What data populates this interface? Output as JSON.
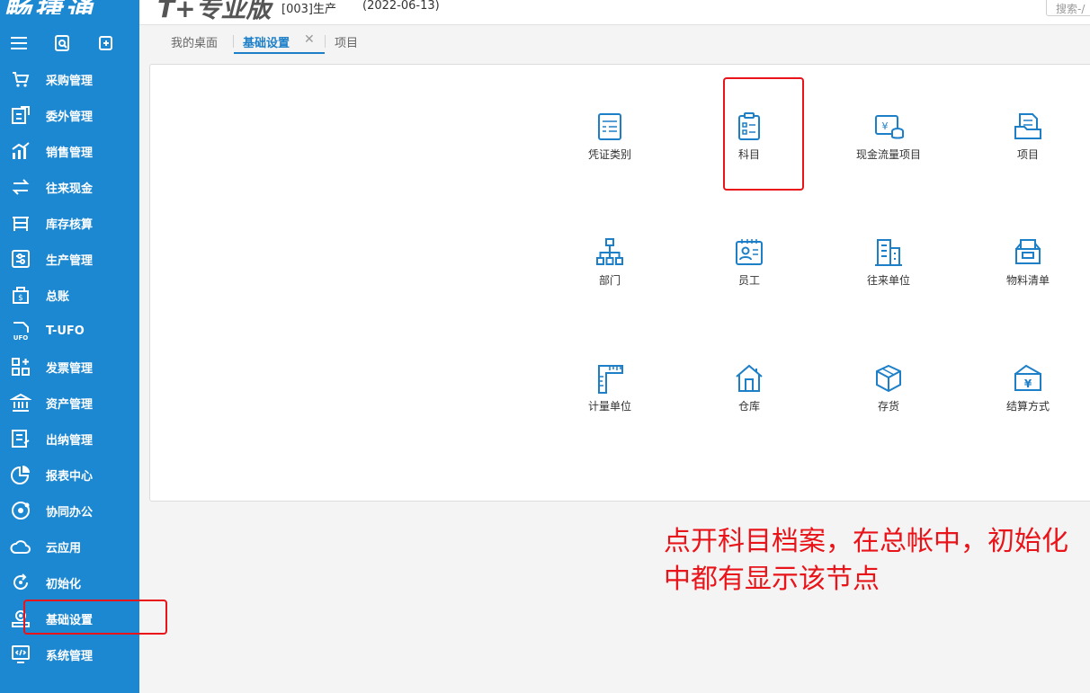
{
  "app": {
    "brand": "畅捷通",
    "product": "T+专业版",
    "account": "[003]生产",
    "date": "(2022-06-13)",
    "search_placeholder": "搜索-/"
  },
  "tabs": [
    {
      "label": "我的桌面"
    },
    {
      "label": "基础设置"
    },
    {
      "label": "项目"
    }
  ],
  "sidebar": {
    "items": [
      {
        "label": "采购管理",
        "icon": "cart-icon"
      },
      {
        "label": "委外管理",
        "icon": "outsource-icon"
      },
      {
        "label": "销售管理",
        "icon": "sales-chart-icon"
      },
      {
        "label": "往来现金",
        "icon": "exchange-icon"
      },
      {
        "label": "库存核算",
        "icon": "inventory-icon"
      },
      {
        "label": "生产管理",
        "icon": "production-icon"
      },
      {
        "label": "总账",
        "icon": "ledger-icon"
      },
      {
        "label": "T-UFO",
        "icon": "ufo-icon"
      },
      {
        "label": "发票管理",
        "icon": "invoice-icon"
      },
      {
        "label": "资产管理",
        "icon": "asset-bank-icon"
      },
      {
        "label": "出纳管理",
        "icon": "cashier-icon"
      },
      {
        "label": "报表中心",
        "icon": "report-pie-icon"
      },
      {
        "label": "协同办公",
        "icon": "collab-icon"
      },
      {
        "label": "云应用",
        "icon": "cloud-icon"
      },
      {
        "label": "初始化",
        "icon": "init-icon"
      },
      {
        "label": "基础设置",
        "icon": "basic-settings-icon"
      },
      {
        "label": "系统管理",
        "icon": "system-icon"
      }
    ]
  },
  "tiles": [
    {
      "label": "凭证类别",
      "icon": "voucher-icon"
    },
    {
      "label": "科目",
      "icon": "account-subject-icon"
    },
    {
      "label": "现金流量项目",
      "icon": "cashflow-icon"
    },
    {
      "label": "项目",
      "icon": "project-folder-icon"
    },
    {
      "label": "部门",
      "icon": "org-chart-icon"
    },
    {
      "label": "员工",
      "icon": "employee-card-icon"
    },
    {
      "label": "往来单位",
      "icon": "building-icon"
    },
    {
      "label": "物料清单",
      "icon": "bom-icon"
    },
    {
      "label": "计量单位",
      "icon": "ruler-icon"
    },
    {
      "label": "仓库",
      "icon": "warehouse-icon"
    },
    {
      "label": "存货",
      "icon": "box-icon"
    },
    {
      "label": "结算方式",
      "icon": "settlement-icon"
    }
  ],
  "annotation": "点开科目档案，在总帐中，初始化中都有显示该节点",
  "colors": {
    "sidebar": "#1c88d2",
    "accent": "#1c7fc8",
    "highlight": "#e8141a"
  }
}
